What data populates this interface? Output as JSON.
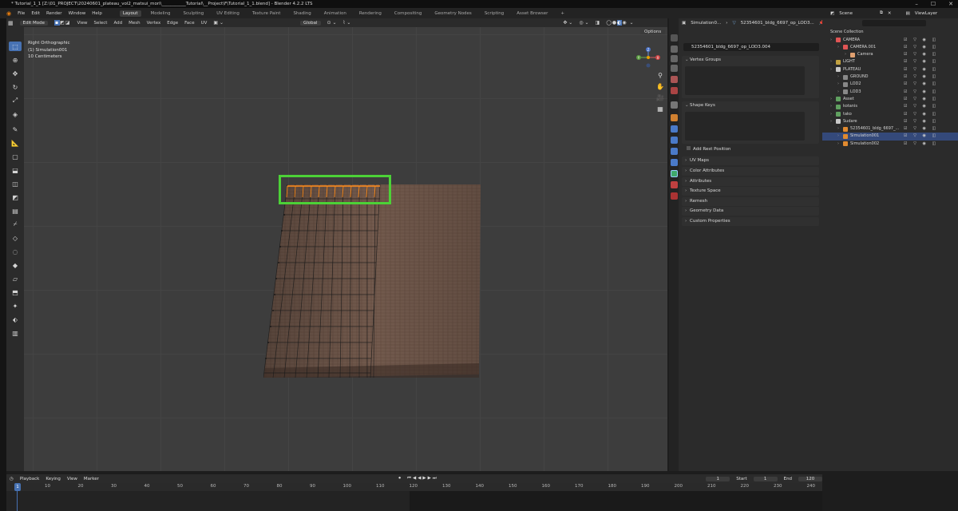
{
  "window": {
    "title": "* Tutorial_1_1 [Z:\\01_PROJECT\\20240601_plateau_vol2_matsui_mori\\___________Tutorial\\__Project\\F\\Tutorial_1_1.blend] - Blender 4.2.2 LTS",
    "controls": [
      "–",
      "☐",
      "✕"
    ]
  },
  "menubar": {
    "items": [
      "File",
      "Edit",
      "Render",
      "Window",
      "Help"
    ],
    "workspaces": [
      "Layout",
      "Modeling",
      "Sculpting",
      "UV Editing",
      "Texture Paint",
      "Shading",
      "Animation",
      "Rendering",
      "Compositing",
      "Geometry Nodes",
      "Scripting",
      "Asset Browser"
    ],
    "active_workspace": "Layout",
    "add_tab": "+"
  },
  "viewport_header": {
    "mode": "Edit Mode",
    "menus": [
      "View",
      "Select",
      "Add",
      "Mesh",
      "Vertex",
      "Edge",
      "Face",
      "UV"
    ],
    "transform_orientation": "Global",
    "options": "Options"
  },
  "viewport_info": {
    "view": "Right Orthographic",
    "object": "(1) Simulation001",
    "scale": "10 Centimeters"
  },
  "gizmo": {
    "x": "X",
    "y": "Y",
    "z": "Z"
  },
  "colors": {
    "accent": "#4772b3",
    "highlight_box": "#4cd137",
    "selected_edge": "#ff8c1a",
    "mesh": "#6b5447"
  },
  "properties_header": {
    "breadcrumb_object": "Simulation0...",
    "breadcrumb_sep": "›",
    "breadcrumb_mesh": "52354601_bldg_6697_op_LOD3..."
  },
  "properties": {
    "mesh_name": "52354601_bldg_6697_op_LOD3.004",
    "panels_open": [
      "Vertex Groups",
      "Shape Keys"
    ],
    "add_rest_position": "Add Rest Position",
    "panels_closed": [
      "UV Maps",
      "Color Attributes",
      "Attributes",
      "Texture Space",
      "Remesh",
      "Geometry Data",
      "Custom Properties"
    ]
  },
  "outliner_header": {
    "scene": "Scene",
    "view_layer": "ViewLayer",
    "search_placeholder": "",
    "root": "Scene Collection"
  },
  "outliner": {
    "rows": [
      {
        "label": "CAMERA",
        "indent": 1,
        "color": "#e05555"
      },
      {
        "label": "CAMERA.001",
        "indent": 2,
        "color": "#e05555"
      },
      {
        "label": "Camera",
        "indent": 3,
        "color": "#e0a070"
      },
      {
        "label": "LIGHT",
        "indent": 1,
        "color": "#c0a040"
      },
      {
        "label": "PLATEAU",
        "indent": 1,
        "color": "#c8c8c8"
      },
      {
        "label": "GROUND",
        "indent": 2,
        "color": "#888888"
      },
      {
        "label": "LOD2",
        "indent": 2,
        "color": "#888888"
      },
      {
        "label": "LOD3",
        "indent": 2,
        "color": "#888888"
      },
      {
        "label": "Asset",
        "indent": 1,
        "color": "#60a060"
      },
      {
        "label": "kotanis",
        "indent": 1,
        "color": "#60a060"
      },
      {
        "label": "tako",
        "indent": 1,
        "color": "#60a060"
      },
      {
        "label": "Sudare",
        "indent": 1,
        "color": "#c8c8c8"
      },
      {
        "label": "52354601_bldg_6697_...",
        "indent": 2,
        "color": "#e08a30"
      },
      {
        "label": "Simulation001",
        "indent": 2,
        "color": "#e08a30",
        "selected": true
      },
      {
        "label": "Simulation002",
        "indent": 2,
        "color": "#e08a30"
      }
    ]
  },
  "timeline": {
    "menus": [
      "Playback",
      "Keying",
      "View",
      "Marker"
    ],
    "current_frame": "1",
    "start_label": "Start",
    "start": "1",
    "end_label": "End",
    "end": "120",
    "playhead": "1",
    "ticks": [
      "10",
      "20",
      "30",
      "40",
      "50",
      "60",
      "70",
      "80",
      "90",
      "100",
      "110",
      "120",
      "130",
      "140",
      "150",
      "160",
      "170",
      "180",
      "190",
      "200",
      "210",
      "220",
      "230",
      "240"
    ]
  }
}
